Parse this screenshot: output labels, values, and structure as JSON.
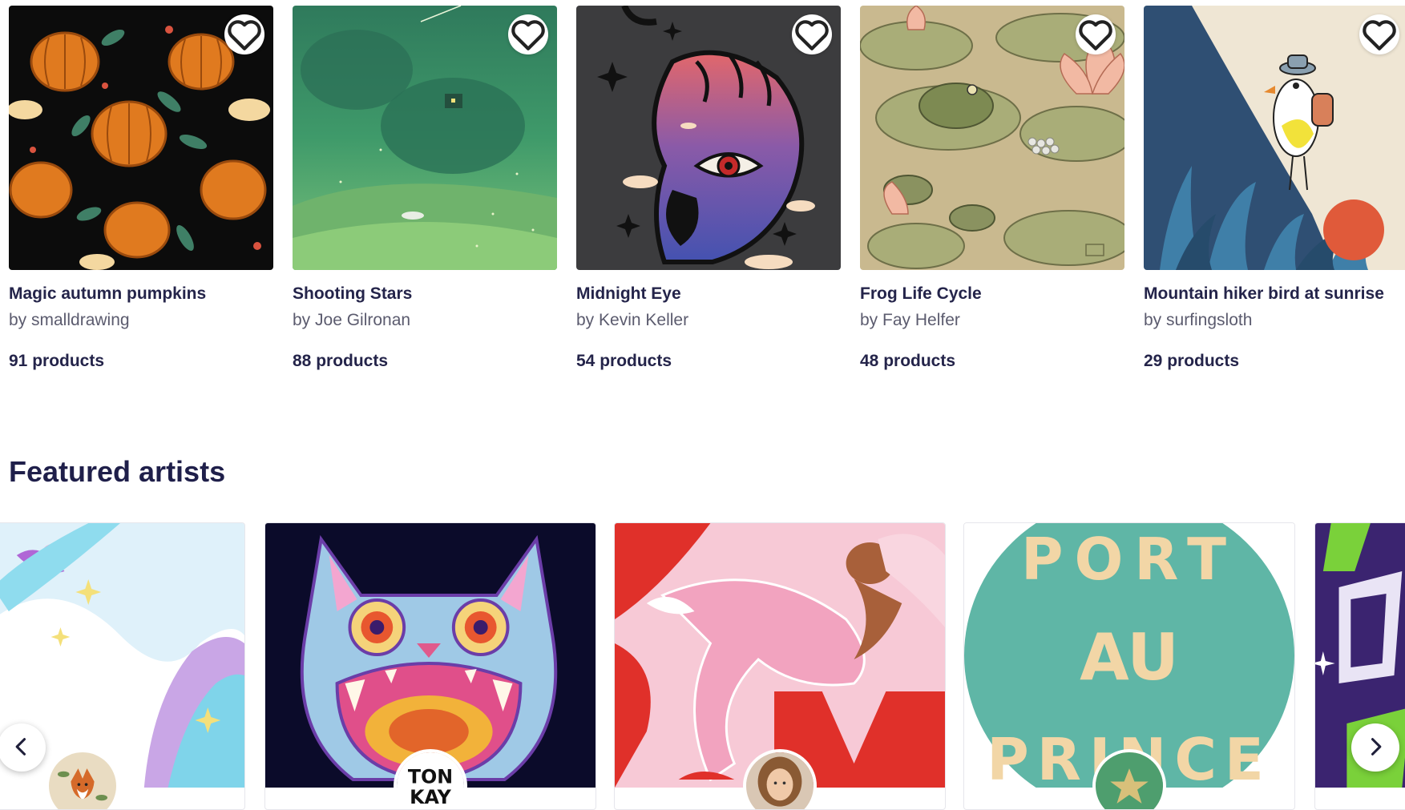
{
  "designs": [
    {
      "title": "Magic autumn pumpkins",
      "artist": "by smalldrawing",
      "count": "91 products",
      "favorite_icon": "heart-outline-icon"
    },
    {
      "title": "Shooting Stars",
      "artist": "by Joe Gilronan",
      "count": "88 products",
      "favorite_icon": "heart-outline-icon"
    },
    {
      "title": "Midnight Eye",
      "artist": "by Kevin Keller",
      "count": "54 products",
      "favorite_icon": "heart-outline-icon"
    },
    {
      "title": "Frog Life Cycle",
      "artist": "by Fay Helfer",
      "count": "48 products",
      "favorite_icon": "heart-outline-icon"
    },
    {
      "title": "Mountain hiker bird at sunrise",
      "artist": "by surfingsloth",
      "count": "29 products",
      "favorite_icon": "heart-outline-icon"
    }
  ],
  "featured_artists": {
    "heading": "Featured artists",
    "prev_icon": "chevron-left-icon",
    "next_icon": "chevron-right-icon",
    "artwork_text": {
      "tonkay_logo": "TONKAY",
      "port_au_prince_top": "PORT",
      "port_au_prince_middle": "AU",
      "port_au_prince_bottom": "PRINCE"
    }
  },
  "colors": {
    "heading_text": "#1f1f4a",
    "title_text": "#24244a",
    "secondary_text": "#5b5b6e",
    "card_border": "#e6e6ec"
  }
}
